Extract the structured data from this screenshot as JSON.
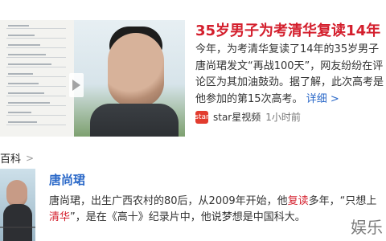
{
  "news": {
    "title": "35岁男子为考清华复读14年",
    "description_text": "今年，为考清华复读了14年的35岁男子唐尚珺发文“再战100天”，网友纷纷在评论区为其加油鼓劲。据了解，此次高考是他参加的第15次高考。",
    "details_link": "详细 >",
    "source": {
      "logo_text": "star",
      "name": "star星视频",
      "time": "1小时前"
    }
  },
  "baike": {
    "header": "百科",
    "chevron": ">",
    "person": {
      "name": "唐尚珺",
      "desc_part1": "唐尚珺，出生广西农村的80后，从2009年开始，他",
      "highlight1": "复读",
      "desc_part2": "多年，“只想上",
      "highlight2": "清华",
      "desc_part3": "”，是在《高十》纪录片中，他说梦想是中国科大。"
    }
  },
  "watermark": "娱乐"
}
